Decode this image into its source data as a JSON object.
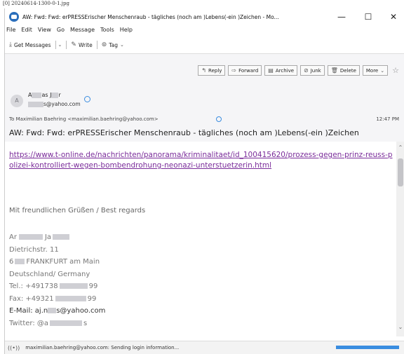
{
  "caption": "[0] 20240614-1300-0-1.jpg",
  "window": {
    "title": "AW: Fwd: Fwd: erPRESSErischer Menschenraub - tägliches (noch am )Lebens(-ein )Zeichen - Mo...",
    "minimize": "—",
    "maximize": "☐",
    "close": "✕"
  },
  "menu": [
    "File",
    "Edit",
    "View",
    "Go",
    "Message",
    "Tools",
    "Help"
  ],
  "toolbar": {
    "get_messages": "Get Messages",
    "write": "Write",
    "tag": "Tag"
  },
  "actions": [
    "Reply",
    "Forward",
    "Archive",
    "Junk",
    "Delete",
    "More"
  ],
  "icons": {
    "reply": "↰",
    "forward": "⇨",
    "archive": "▤",
    "junk": "⊘",
    "delete": "🗑",
    "star": "☆",
    "chevron": "⌄",
    "get_messages": "⤓",
    "write": "✎",
    "tag": "⊚",
    "status": "((•))",
    "scroll_up": "⌃",
    "scroll_down": "⌄"
  },
  "message": {
    "avatar_initial": "A",
    "sender_name_start": "A",
    "sender_name_mid": "as J",
    "sender_name_end": "r",
    "sender_email_end": "s@yahoo.com",
    "to_line": "To  Maximilian Baehring <maximilian.baehring@yahoo.com>",
    "time": "12:47 PM",
    "subject": "AW: Fwd: Fwd: erPRESSErischer Menschenraub - tägliches (noch am )Lebens(-ein )Zeichen"
  },
  "body": {
    "link": "https://www.t-online.de/nachrichten/panorama/kriminalitaet/id_100415620/prozess-gegen-prinz-reuss-polizei-kontrolliert-wegen-bombendrohung-neonazi-unterstuetzerin.html",
    "greeting": "Mit freundlichen Grüßen / Best regards",
    "sig_name_start": "Ar",
    "sig_name_mid": "Ja",
    "street": "Dietrichstr. 11",
    "city_start": "6",
    "city_end": "FRANKFURT am Main",
    "country": "Deutschland/ Germany",
    "tel_start": "Tel.: +491738",
    "tel_end": "99",
    "fax_start": "Fax: +49321",
    "fax_end": "99",
    "email_start": "E-Mail: aj.n",
    "email_end": "s@yahoo.com",
    "twitter_start": "Twitter: @a",
    "twitter_end": "s"
  },
  "status": {
    "text": "maximilian.baehring@yahoo.com: Sending login information...",
    "progress": 1.0
  }
}
